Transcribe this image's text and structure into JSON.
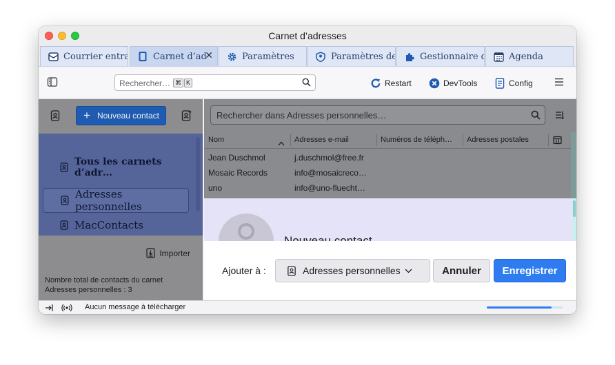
{
  "window": {
    "title": "Carnet d’adresses"
  },
  "tabs": [
    {
      "label": "Courrier entra",
      "icon": "mail-icon"
    },
    {
      "label": "Carnet d’ad",
      "icon": "address-book-icon",
      "active": true
    },
    {
      "label": "Paramètres",
      "icon": "gear-icon"
    },
    {
      "label": "Paramètres de",
      "icon": "account-settings-icon"
    },
    {
      "label": "Gestionnaire d",
      "icon": "puzzle-icon"
    },
    {
      "label": "Agenda",
      "icon": "calendar-icon"
    }
  ],
  "toolbar": {
    "search_placeholder": "Rechercher…",
    "shortcut_keys": [
      "⌘",
      "K"
    ],
    "restart_label": "Restart",
    "devtools_label": "DevTools",
    "config_label": "Config"
  },
  "sidebar": {
    "new_contact_label": "Nouveau contact",
    "books": [
      {
        "label": "Tous les carnets d’adr…",
        "selected": false
      },
      {
        "label": "Adresses personnelles",
        "selected": true
      },
      {
        "label": "MacContacts",
        "selected": false
      }
    ],
    "import_label": "Importer",
    "count_line1": "Nombre total de contacts du carnet",
    "count_line2": "Adresses personnelles : 3"
  },
  "main": {
    "search_placeholder": "Rechercher dans Adresses personnelles…",
    "columns": [
      "Nom",
      "Adresses e-mail",
      "Numéros de téléph…",
      "Adresses postales"
    ],
    "rows": [
      {
        "name": "Jean Duschmol",
        "email": "j.duschmol@free.fr",
        "phone": "",
        "address": ""
      },
      {
        "name": "Mosaic Records",
        "email": "info@mosaicreco…",
        "phone": "",
        "address": ""
      },
      {
        "name": "uno",
        "email": "info@uno-fluecht…",
        "phone": "",
        "address": ""
      }
    ]
  },
  "card": {
    "title": "Nouveau contact"
  },
  "dialog": {
    "add_to_label": "Ajouter à :",
    "book_value": "Adresses personnelles",
    "cancel_label": "Annuler",
    "save_label": "Enregistrer"
  },
  "statusbar": {
    "message": "Aucun message à télécharger",
    "progress": 0.85
  },
  "colors": {
    "accent": "#2e7cf0",
    "new_contact_button": "#1f5bb0",
    "tab_active": "#c9d6ef",
    "tab_inactive": "#dfe6f5"
  }
}
